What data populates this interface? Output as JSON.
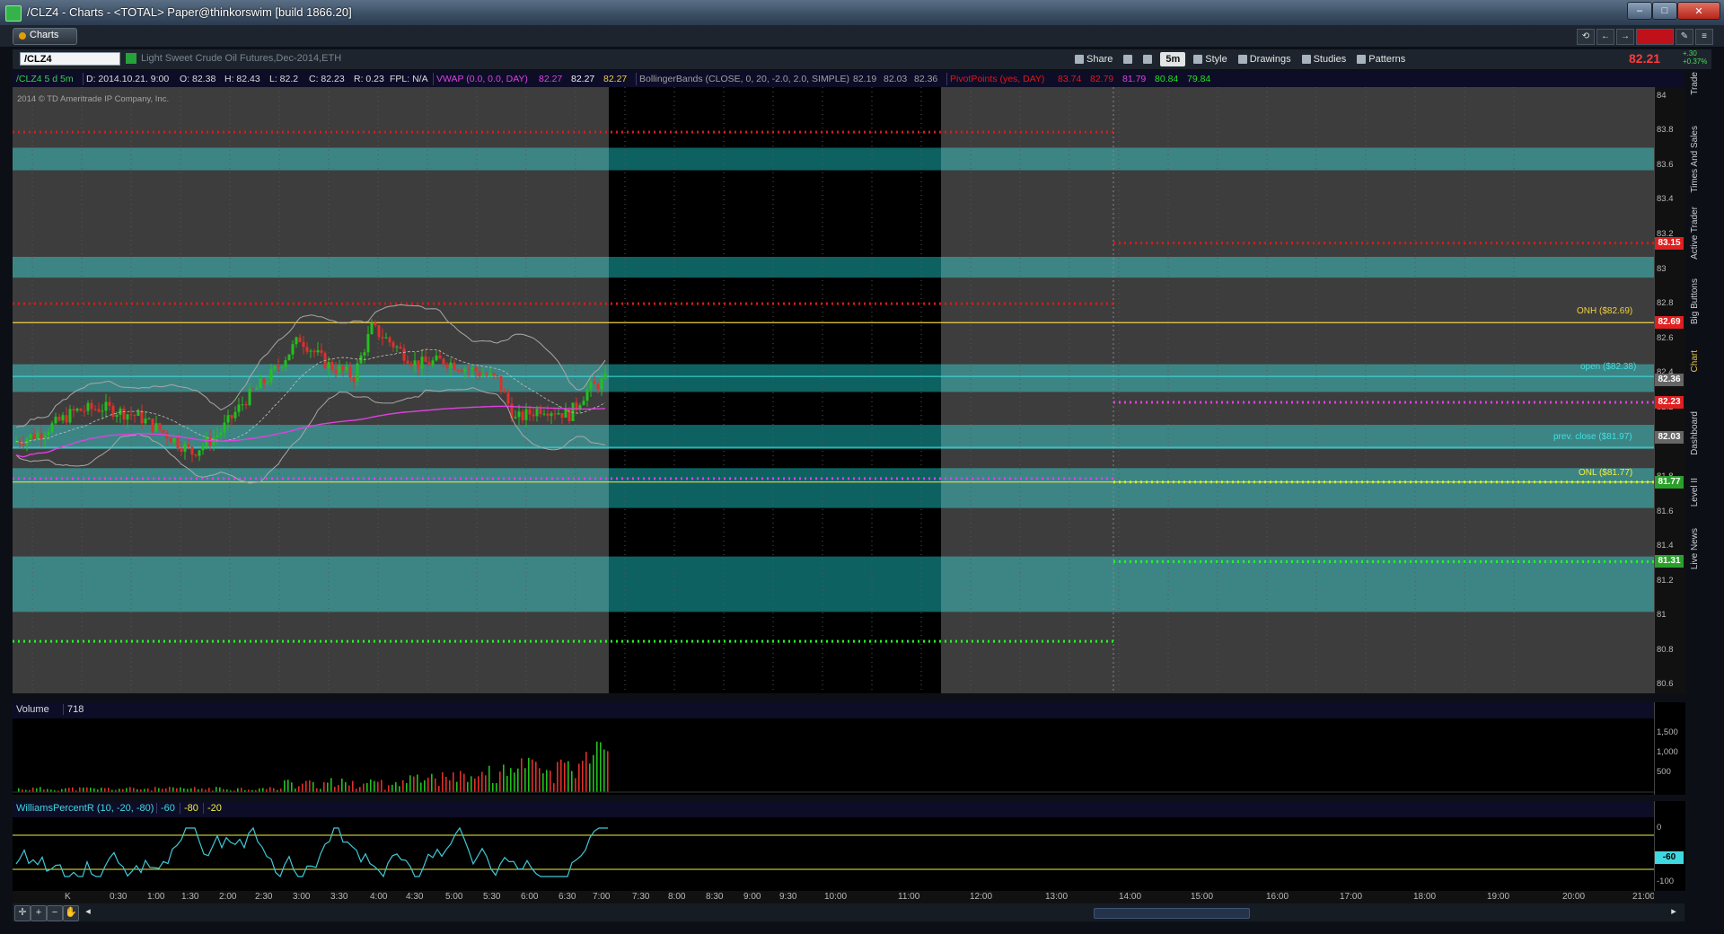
{
  "window": {
    "title": "/CLZ4 - Charts - <TOTAL> Paper@thinkorswim [build 1866.20]",
    "minimize": "–",
    "maximize": "□",
    "close": "✕"
  },
  "tabs": {
    "charts": "Charts"
  },
  "symbol": {
    "value": "/CLZ4",
    "description": "Light Sweet Crude Oil Futures,Dec-2014,ETH"
  },
  "toolbar": {
    "share": "Share",
    "aggregation": "5m",
    "style": "Style",
    "drawings": "Drawings",
    "studies": "Studies",
    "patterns": "Patterns"
  },
  "quote": {
    "last": "82.21",
    "change": "+.30",
    "change_pct": "+0.37%"
  },
  "infobar": {
    "series": "/CLZ4 5 d 5m",
    "date": "D: 2014.10.21. 9:00",
    "open": "O: 82.38",
    "high": "H: 82.43",
    "low": "L: 82.2",
    "close": "C: 82.23",
    "range": "R: 0.23",
    "fpl": "FPL: N/A",
    "vwap_label": "VWAP (0.0, 0.0, DAY)",
    "vwap_values": [
      "82.27",
      "82.27",
      "82.27"
    ],
    "bb_label": "BollingerBands (CLOSE, 0, 20, -2.0, 2.0, SIMPLE)",
    "bb_values": [
      "82.19",
      "82.03",
      "82.36"
    ],
    "pivot_label": "PivotPoints (yes, DAY)",
    "pivot_values": [
      "83.74",
      "82.79",
      "81.79",
      "80.84",
      "79.84"
    ]
  },
  "copyright": "2014 © TD Ameritrade IP Company, Inc.",
  "price_axis": {
    "ticks": [
      "84",
      "83.8",
      "83.6",
      "83.4",
      "83.2",
      "83",
      "82.8",
      "82.6",
      "82.4",
      "82.2",
      "82",
      "81.8",
      "81.6",
      "81.4",
      "81.2",
      "81",
      "80.8",
      "80.6"
    ],
    "tags": [
      {
        "value": "83.15",
        "color": "#e02020"
      },
      {
        "value": "82.69",
        "color": "#e02020"
      },
      {
        "value": "82.36",
        "color": "#666666"
      },
      {
        "value": "82.23",
        "color": "#e02020"
      },
      {
        "value": "82.03",
        "color": "#666666"
      },
      {
        "value": "81.77",
        "color": "#2aa02a"
      },
      {
        "value": "81.31",
        "color": "#2aa02a"
      }
    ]
  },
  "levels": {
    "onh": "ONH ($82.69)",
    "open": "open ($82.38)",
    "prev_close": "prev. close ($81.97)",
    "onl": "ONL ($81.77)"
  },
  "volume": {
    "label": "Volume",
    "value": "718",
    "ticks": [
      "1,500",
      "1,000",
      "500"
    ]
  },
  "wpr": {
    "label": "WilliamsPercentR (10, -20, -80)",
    "values": [
      "-60",
      "-80",
      "-20"
    ],
    "ticks": [
      "0",
      "-100"
    ],
    "tag": "-60"
  },
  "time_axis": [
    "K",
    "0:30",
    "1:00",
    "1:30",
    "2:00",
    "2:30",
    "3:00",
    "3:30",
    "4:00",
    "4:30",
    "5:00",
    "5:30",
    "6:00",
    "6:30",
    "7:00",
    "7:30",
    "8:00",
    "8:30",
    "9:00",
    "9:30",
    "10:00",
    "11:00",
    "12:00",
    "13:00",
    "14:00",
    "15:00",
    "16:00",
    "17:00",
    "18:00",
    "19:00",
    "20:00",
    "21:00"
  ],
  "side_tabs": [
    "Trade",
    "Times And Sales",
    "Active Trader",
    "Big Buttons",
    "Chart",
    "Dashboard",
    "Level II",
    "Live News"
  ],
  "colors": {
    "background": "#3d3d3d",
    "band": "#3d9a9a",
    "session_black": "#000000",
    "up": "#22c01e",
    "down": "#e0302a",
    "pivot_red": "#e01818",
    "pivot_green": "#22ff22",
    "vwap": "#e040e0",
    "onh": "#f0d040",
    "open": "#40e0e0"
  }
}
